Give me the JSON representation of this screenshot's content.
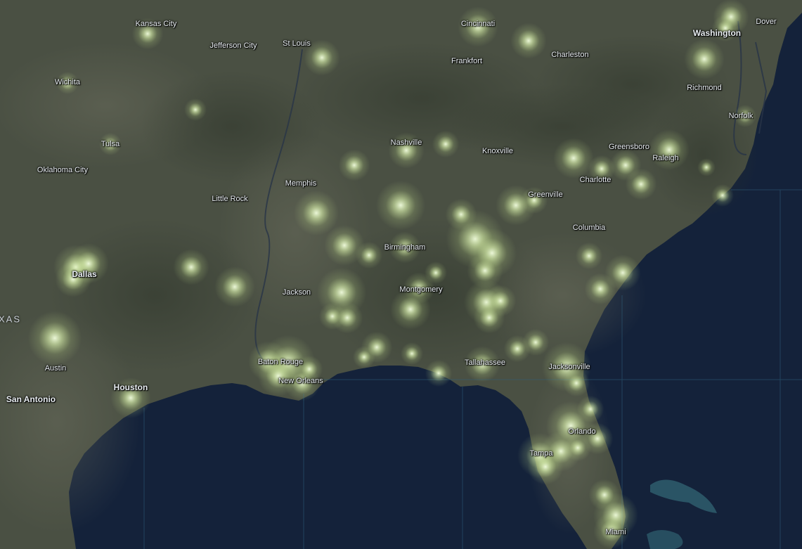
{
  "map": {
    "colors": {
      "ocean": "#14223a",
      "land": "#4a5043",
      "land_dark": "#3a4034",
      "gridline": "#2f5f7a",
      "heat_core": "#f0ffd8",
      "heat_glow": "#dfffa8"
    },
    "state_label": "XAS",
    "cities": [
      {
        "name": "Kansas City"
      },
      {
        "name": "Jefferson City"
      },
      {
        "name": "St Louis"
      },
      {
        "name": "Cincinnati"
      },
      {
        "name": "Frankfort"
      },
      {
        "name": "Charleston"
      },
      {
        "name": "Washington"
      },
      {
        "name": "Dover"
      },
      {
        "name": "Wichita"
      },
      {
        "name": "Richmond"
      },
      {
        "name": "Norfolk"
      },
      {
        "name": "Tulsa"
      },
      {
        "name": "Oklahoma City"
      },
      {
        "name": "Nashville"
      },
      {
        "name": "Knoxville"
      },
      {
        "name": "Greensboro"
      },
      {
        "name": "Raleigh"
      },
      {
        "name": "Memphis"
      },
      {
        "name": "Little Rock"
      },
      {
        "name": "Charlotte"
      },
      {
        "name": "Greenville"
      },
      {
        "name": "Columbia"
      },
      {
        "name": "Birmingham"
      },
      {
        "name": "Dallas"
      },
      {
        "name": "Jackson"
      },
      {
        "name": "Montgomery"
      },
      {
        "name": "Austin"
      },
      {
        "name": "Baton Rouge"
      },
      {
        "name": "Tallahassee"
      },
      {
        "name": "Jacksonville"
      },
      {
        "name": "Houston"
      },
      {
        "name": "New Orleans"
      },
      {
        "name": "San Antonio"
      },
      {
        "name": "Orlando"
      },
      {
        "name": "Tampa"
      },
      {
        "name": "Miami"
      }
    ]
  }
}
